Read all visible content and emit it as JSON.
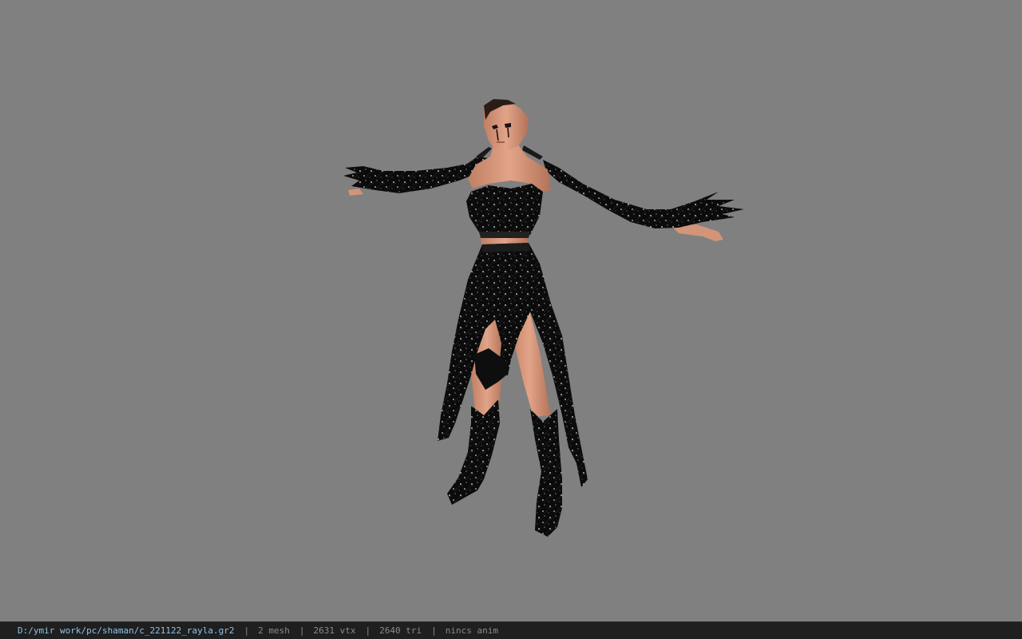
{
  "statusbar": {
    "file_path": "D:/ymir work/pc/shaman/c_221122_rayla.gr2",
    "separator": "|",
    "mesh_count": "2 mesh",
    "vertex_count": "2631 vtx",
    "triangle_count": "2640 tri",
    "anim_status": "nincs anim"
  },
  "colors": {
    "viewport_background": "#808080",
    "statusbar_background": "#1f1f1f",
    "path_text": "#8fc3ea",
    "stat_text": "#8a8a8a",
    "outfit": "#0b0b0b",
    "skin": "#d9987a"
  }
}
